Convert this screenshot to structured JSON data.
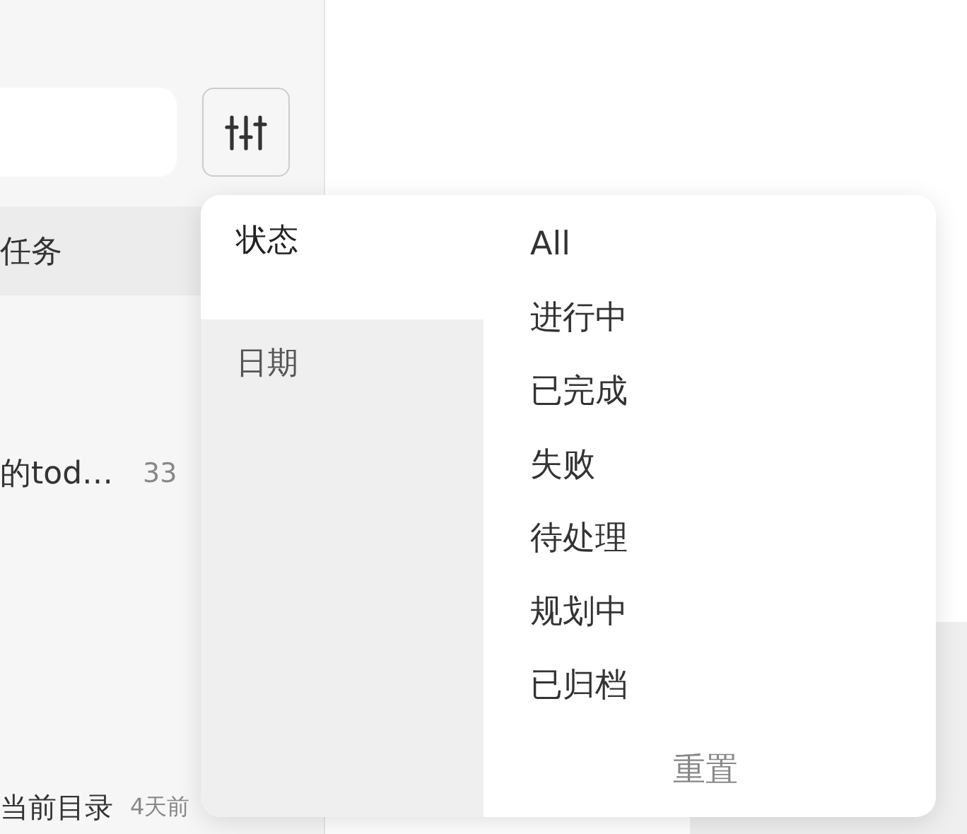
{
  "sidebar": {
    "list_header": "任务",
    "items": [
      {
        "title": "的tod…",
        "time": "33"
      },
      {
        "title": "当前目录",
        "time": "4天前"
      }
    ]
  },
  "filter_popover": {
    "categories": [
      {
        "label": "状态",
        "selected": true
      },
      {
        "label": "日期",
        "selected": false
      }
    ],
    "options": [
      "All",
      "进行中",
      "已完成",
      "失败",
      "待处理",
      "规划中",
      "已归档"
    ],
    "reset": "重置"
  }
}
